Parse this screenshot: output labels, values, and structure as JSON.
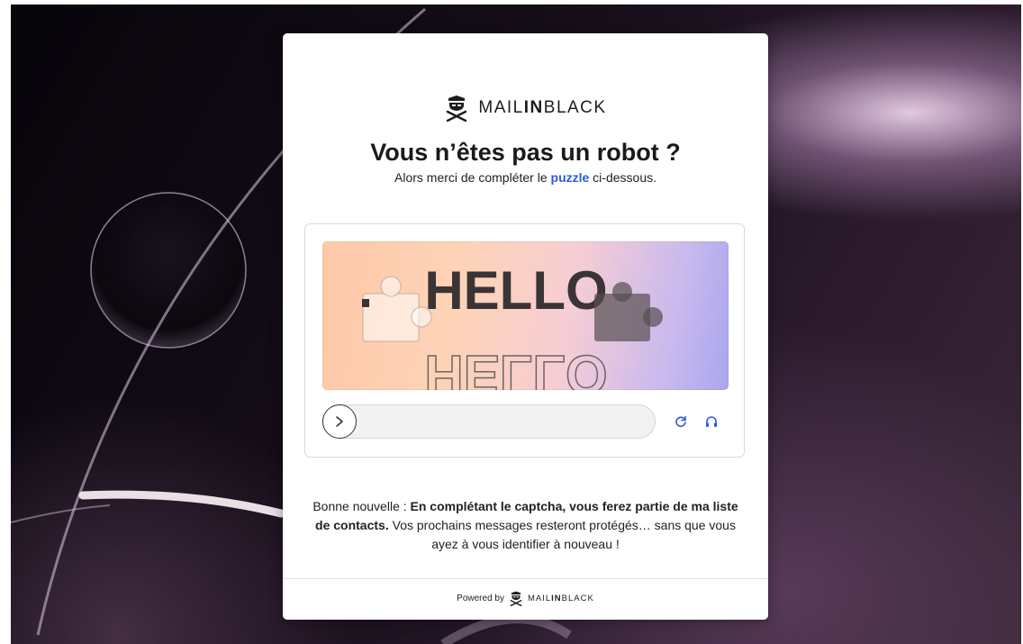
{
  "brand": {
    "name_pre": "MAIL",
    "name_bold": "IN",
    "name_post": "BLACK"
  },
  "heading": {
    "title": "Vous n’êtes pas un robot ?",
    "subtitle_pre": "Alors merci de compléter le ",
    "subtitle_highlight": "puzzle",
    "subtitle_post": " ci-dessous."
  },
  "captcha": {
    "image_text": "HELLO",
    "slider_icon": "chevron-right-icon",
    "refresh_icon": "refresh-icon",
    "audio_icon": "headphones-icon",
    "control_color": "#2d5ae0"
  },
  "info": {
    "text_pre": "Bonne nouvelle : ",
    "text_bold": "En complétant le captcha, vous ferez partie de ma liste de contacts.",
    "text_post": " Vos prochains messages resteront protégés… sans que vous ayez à vous identifier à nouveau !"
  },
  "footer": {
    "powered_by": "Powered by",
    "name_pre": "MAIL",
    "name_bold": "IN",
    "name_post": "BLACK"
  }
}
